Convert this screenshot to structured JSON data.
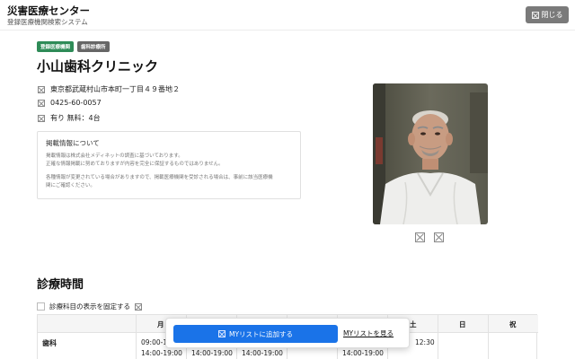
{
  "header": {
    "title": "災害医療センター",
    "subtitle": "登録医療機関検索システム",
    "close_label": "閉じる",
    "close_icon": "close-icon"
  },
  "badges": [
    {
      "label": "登録医療機関",
      "color": "#2e8b57"
    },
    {
      "label": "歯科診療所",
      "color": "#666666"
    }
  ],
  "clinic": {
    "name": "小山歯科クリニック",
    "address": "東京都武蔵村山市本町一丁目４９番地２",
    "phone": "0425-60-0057",
    "parking": "有り  無料：4台"
  },
  "notice": {
    "title": "掲載情報について",
    "line1": "掲載情報は株式会社メディネットの調査に基づいております。",
    "line2": "正確な情報掲載に努めておりますが内容を完全に保証するものではありません。",
    "line3": "各種情報が変更されている場合がありますので、掲載医療機関を受診される場合は、事前に該当医療機",
    "line4": "関にご確認ください。"
  },
  "schedule": {
    "title": "診療時間",
    "fix_label": "診療科目の表示を固定する",
    "days": [
      "月",
      "土",
      "日",
      "祝"
    ],
    "row_label": "歯科",
    "mon_am": "09:00-1",
    "mon_pm": "14:00-19:00",
    "tue_pm": "14:00-19:00",
    "wed_pm": "14:00-19:00",
    "fri_pm": "14:00-19:00",
    "sat_am": "12:30"
  },
  "mylist": {
    "add_label": "MYリストに追加する",
    "view_label": "MYリストを見る"
  },
  "colors": {
    "primary": "#1a73e8",
    "badge_green": "#2e8b57",
    "close_button": "#7a7a7a"
  }
}
